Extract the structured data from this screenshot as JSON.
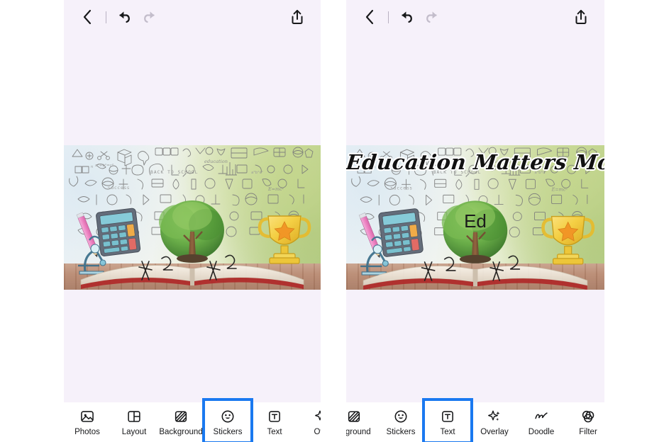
{
  "app": {
    "background_color": "#ffffff",
    "panel_background": "#f6f1fa",
    "toolbar_background": "#ffffff",
    "selection_color": "#1a79f0",
    "icon_color": "#17181a",
    "disabled_icon_color": "#bdb7c4"
  },
  "panels": [
    {
      "id": "left",
      "name": "stickers-step",
      "topbar": {
        "back_label": "Back",
        "undo_label": "Undo",
        "redo_label": "Redo",
        "share_label": "Share",
        "redo_disabled": true
      },
      "canvas": {
        "photo_alt": "Open book with tree, trophy, microscope, calculator and education doodles",
        "overlays": []
      },
      "toolbar": {
        "selected": "Stickers",
        "items": [
          {
            "label": "Photos",
            "icon": "photo-icon",
            "selected": false
          },
          {
            "label": "Layout",
            "icon": "layout-icon",
            "selected": false
          },
          {
            "label": "Background",
            "icon": "background-icon",
            "selected": false
          },
          {
            "label": "Stickers",
            "icon": "sticker-icon",
            "selected": true
          },
          {
            "label": "Text",
            "icon": "text-icon",
            "selected": false
          },
          {
            "label": "Ove",
            "icon": "overlay-icon",
            "selected": false
          }
        ]
      }
    },
    {
      "id": "right",
      "name": "text-step",
      "topbar": {
        "back_label": "Back",
        "undo_label": "Undo",
        "redo_label": "Redo",
        "share_label": "Share",
        "redo_disabled": true
      },
      "canvas": {
        "photo_alt": "Open book with tree, trophy, microscope, calculator and education doodles",
        "overlays": [
          {
            "type": "title-text",
            "text": "Education Matters Most",
            "color": "#111111",
            "outline": "#ffffff"
          },
          {
            "type": "sticker-text",
            "text": "Ed",
            "color": "#1b1b1b"
          }
        ]
      },
      "toolbar": {
        "selected": "Text",
        "items": [
          {
            "label": "ckground",
            "icon": "background-icon",
            "selected": false
          },
          {
            "label": "Stickers",
            "icon": "sticker-icon",
            "selected": false
          },
          {
            "label": "Text",
            "icon": "text-icon",
            "selected": true
          },
          {
            "label": "Overlay",
            "icon": "overlay-icon",
            "selected": false
          },
          {
            "label": "Doodle",
            "icon": "doodle-icon",
            "selected": false
          },
          {
            "label": "Filter",
            "icon": "filter-icon",
            "selected": false
          }
        ]
      }
    }
  ]
}
